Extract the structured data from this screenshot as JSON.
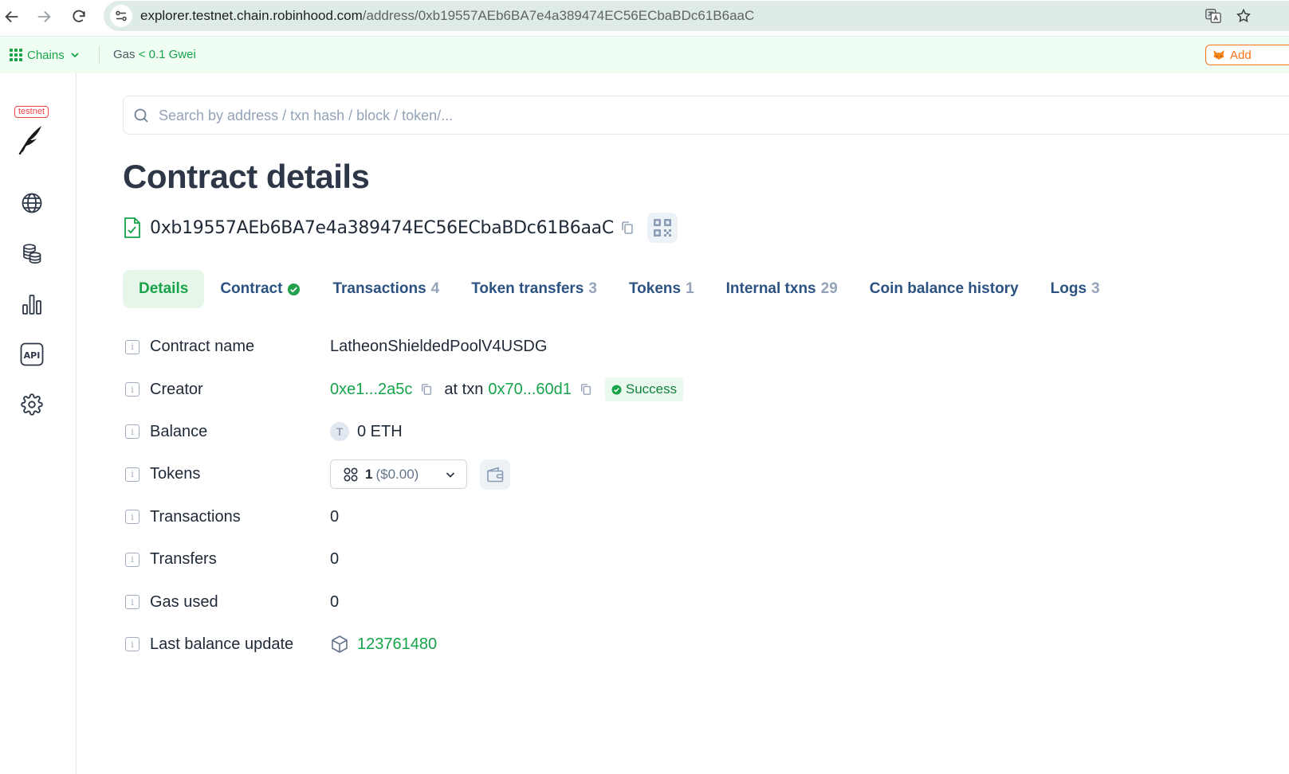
{
  "browser": {
    "url_host": "explorer.testnet.chain.robinhood.com",
    "url_path": "/address/0xb19557AEb6BA7e4a389474EC56ECbaBDc61B6aaC"
  },
  "top_strip": {
    "chains_label": "Chains",
    "gas_prefix": "Gas",
    "gas_value": "< 0.1 Gwei",
    "wallet_button_label": "Add"
  },
  "sidebar": {
    "network_badge": "testnet",
    "items": [
      {
        "icon": "globe-icon"
      },
      {
        "icon": "coins-icon"
      },
      {
        "icon": "bar-chart-icon"
      },
      {
        "icon": "api-icon"
      },
      {
        "icon": "gear-icon"
      }
    ]
  },
  "search": {
    "placeholder": "Search by address / txn hash / block / token/..."
  },
  "page": {
    "title": "Contract details",
    "address": "0xb19557AEb6BA7e4a389474EC56ECbaBDc61B6aaC"
  },
  "tabs": [
    {
      "label": "Details",
      "count": "",
      "active": true
    },
    {
      "label": "Contract",
      "count": "",
      "verified": true
    },
    {
      "label": "Transactions",
      "count": "4"
    },
    {
      "label": "Token transfers",
      "count": "3"
    },
    {
      "label": "Tokens",
      "count": "1"
    },
    {
      "label": "Internal txns",
      "count": "29"
    },
    {
      "label": "Coin balance history",
      "count": ""
    },
    {
      "label": "Logs",
      "count": "3"
    }
  ],
  "details": {
    "contract_name": {
      "label": "Contract name",
      "value": "LatheonShieldedPoolV4USDG"
    },
    "creator": {
      "label": "Creator",
      "address": "0xe1...2a5c",
      "at_txn": "at txn",
      "txn": "0x70...60d1",
      "status": "Success"
    },
    "balance": {
      "label": "Balance",
      "coin_letter": "T",
      "value": "0 ETH"
    },
    "tokens": {
      "label": "Tokens",
      "count": "1",
      "usd": "($0.00)"
    },
    "transactions": {
      "label": "Transactions",
      "value": "0"
    },
    "transfers": {
      "label": "Transfers",
      "value": "0"
    },
    "gas_used": {
      "label": "Gas used",
      "value": "0"
    },
    "last_balance_update": {
      "label": "Last balance update",
      "value": "123761480"
    }
  },
  "colors": {
    "accent_green": "#16a34a",
    "tab_blue": "#2c5282",
    "muted": "#94a3b8"
  }
}
